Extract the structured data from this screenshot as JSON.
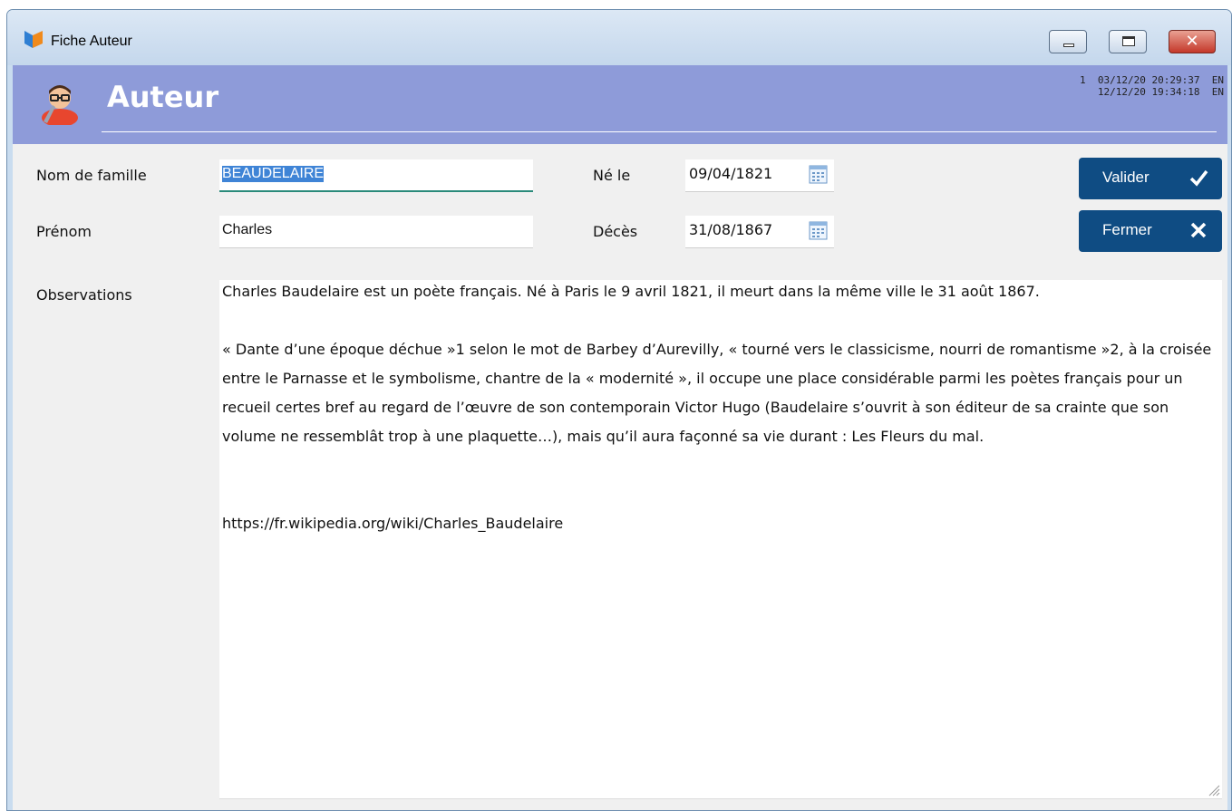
{
  "window": {
    "title": "Fiche Auteur",
    "close_glyph": "✕"
  },
  "header": {
    "title": "Auteur",
    "icon": "author-avatar-icon",
    "meta_line1": "1  03/12/20 20:29:37  EN",
    "meta_line2": "12/12/20 19:34:18  EN",
    "color": "#8e9bd9"
  },
  "form": {
    "nom_label": "Nom de famille",
    "nom_value": "BEAUDELAIRE",
    "prenom_label": "Prénom",
    "prenom_value": "Charles",
    "ne_label": "Né le",
    "ne_value": "09/04/1821",
    "deces_label": "Décès",
    "deces_value": "31/08/1867",
    "observations_label": "Observations",
    "observations": {
      "p1": "Charles Baudelaire est un poète français. Né à Paris le 9 avril 1821, il meurt dans la même ville le 31 août 1867.",
      "p2": "« Dante d’une époque déchue »1 selon le mot de Barbey d’Aurevilly, « tourné vers le classicisme, nourri de romantisme »2, à la croisée entre le Parnasse et le symbolisme, chantre de la « modernité », il occupe une place considérable parmi les poètes français pour un recueil certes bref au regard de l’œuvre de son contemporain Victor Hugo (Baudelaire s’ouvrit à son éditeur de sa crainte que son volume ne ressemblât trop à une plaquette…), mais qu’il aura façonné sa vie durant : Les Fleurs du mal.",
      "p3": "https://fr.wikipedia.org/wiki/Charles_Baudelaire"
    }
  },
  "buttons": {
    "valider": "Valider",
    "fermer": "Fermer",
    "color": "#0f4c83"
  }
}
